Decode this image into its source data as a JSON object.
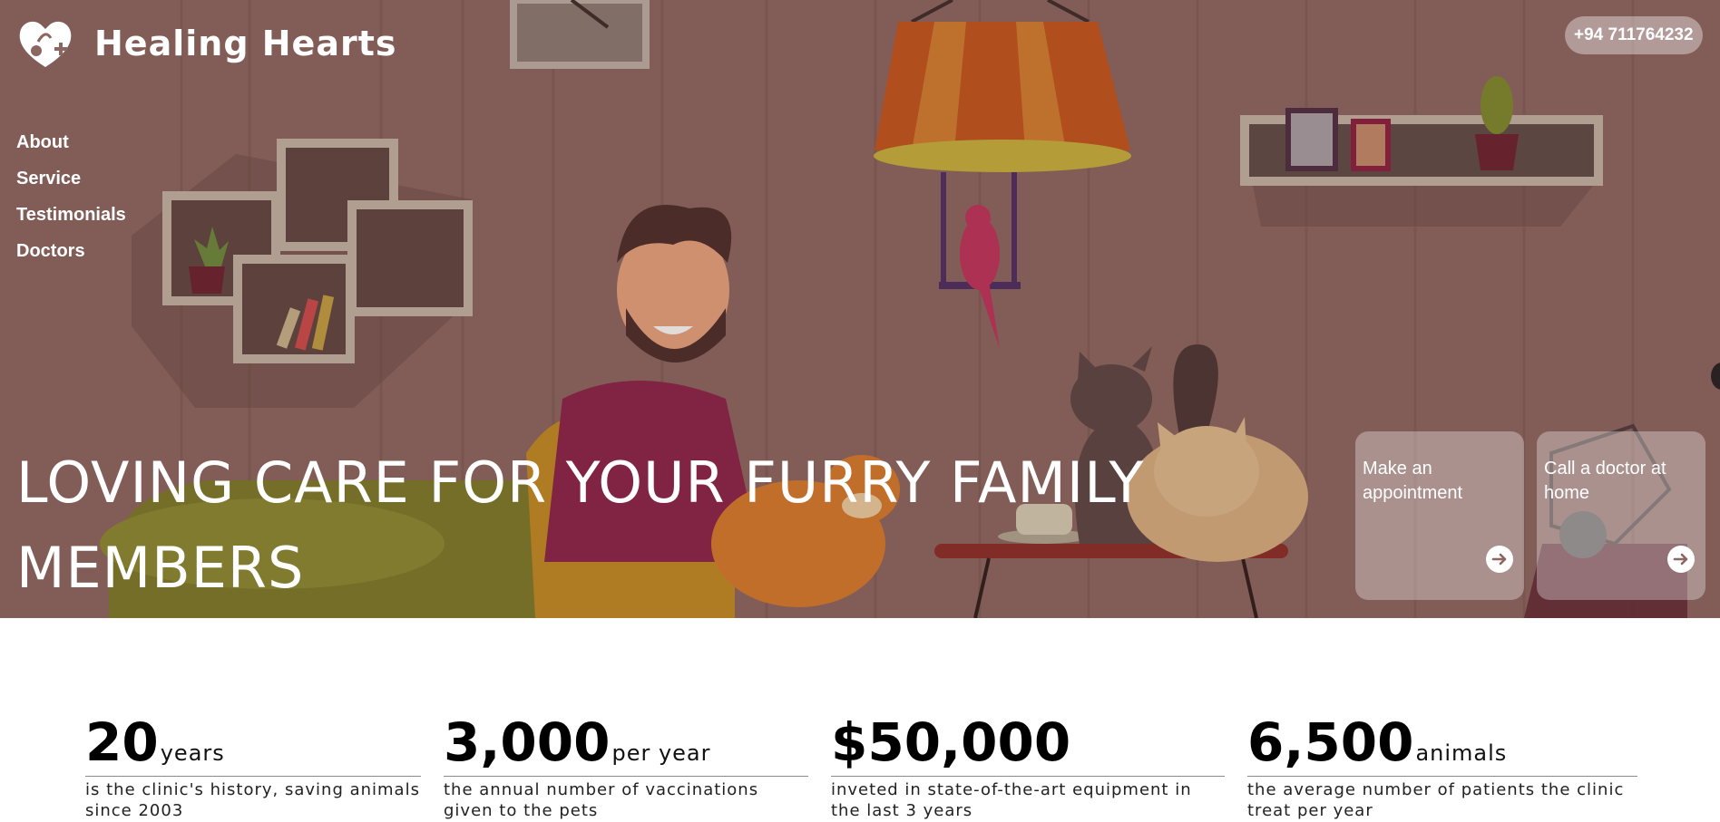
{
  "brand": {
    "name": "Healing Hearts",
    "logo_icon": "heart-paw-icon"
  },
  "header": {
    "phone": "+94 711764232"
  },
  "nav": {
    "items": [
      "About",
      "Service",
      "Testimonials",
      "Doctors"
    ]
  },
  "hero": {
    "title": "LOVING CARE FOR YOUR FURRY FAMILY MEMBERS",
    "cards": [
      {
        "label": "Make an appointment",
        "icon": "arrow-right-icon"
      },
      {
        "label": "Call a doctor at home",
        "icon": "arrow-right-icon"
      }
    ]
  },
  "stats": [
    {
      "number": "20",
      "unit": "years",
      "desc": "is the clinic's history, saving animals since 2003"
    },
    {
      "number": "3,000",
      "unit": "per year",
      "desc": "the annual number of vaccinations given to the pets"
    },
    {
      "number": "$50,000",
      "unit": "",
      "desc": "inveted in state-of-the-art equipment in the last 3 years"
    },
    {
      "number": "6,500",
      "unit": "animals",
      "desc": "the average number of patients the clinic treat per year"
    }
  ],
  "colors": {
    "hero_bg": "#8c6660",
    "text_light": "#ffffff",
    "accent_red": "#8b1a3c"
  }
}
